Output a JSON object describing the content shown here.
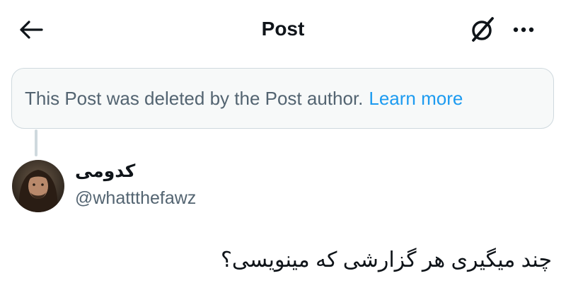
{
  "header": {
    "title": "Post",
    "back_icon": "arrow-left-icon",
    "grok_icon": "grok-icon",
    "more_icon": "more-horizontal-icon"
  },
  "notice": {
    "text": "This Post was deleted by the Post author.",
    "link_label": "Learn more",
    "link_color": "#1d9bf0"
  },
  "post": {
    "author_name": "کدومی",
    "author_handle": "@whattthefawz",
    "text": "چند میگیری هر گزارشی که مینویسی؟"
  }
}
